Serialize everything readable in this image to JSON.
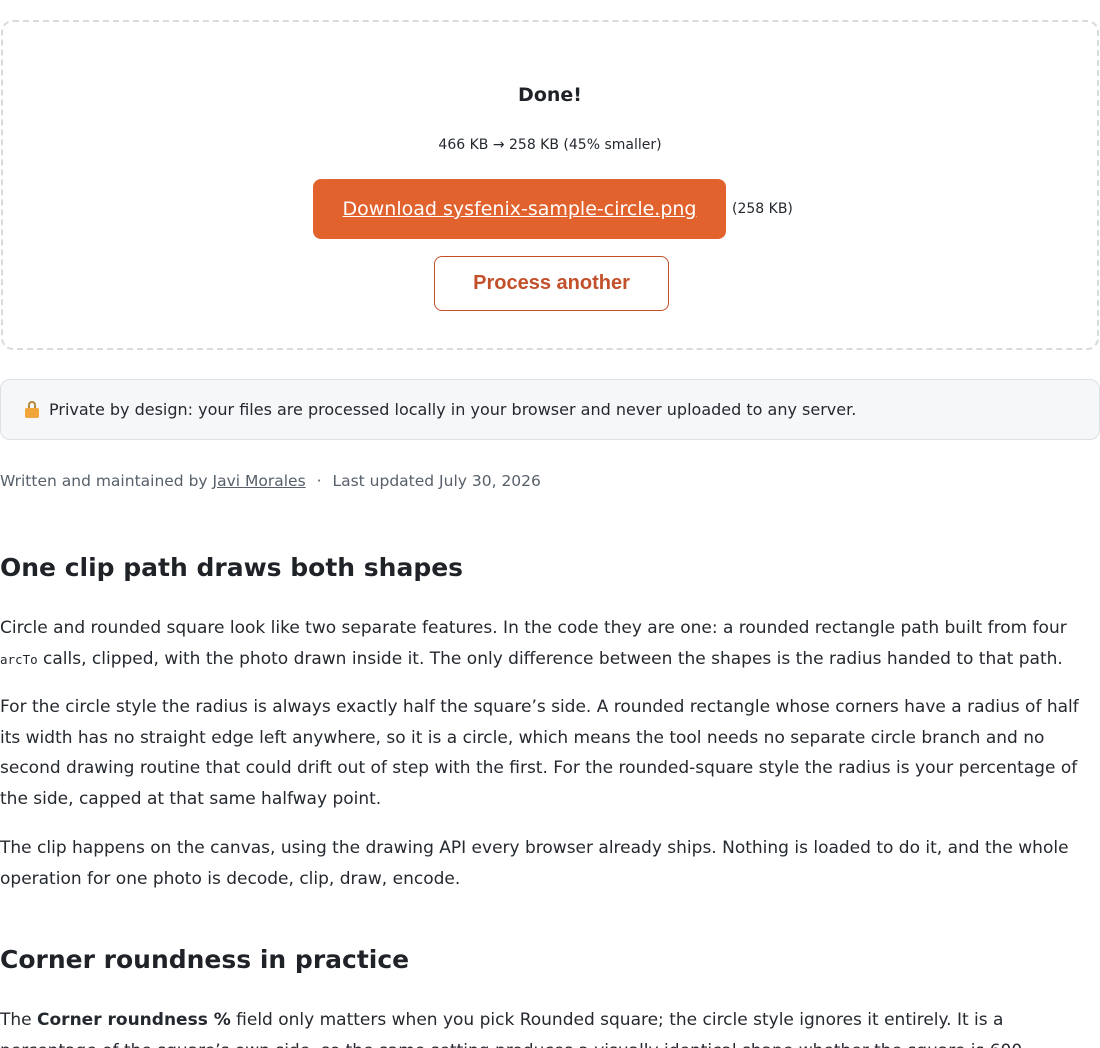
{
  "result": {
    "title": "Done!",
    "size_summary": "466 KB → 258 KB (45% smaller)",
    "download_label": "Download sysfenix-sample-circle.png",
    "download_size": "(258 KB)",
    "process_another_label": "Process another"
  },
  "privacy": {
    "icon": "lock-icon",
    "text": "Private by design: your files are processed locally in your browser and never uploaded to any server."
  },
  "byline": {
    "prefix": "Written and maintained by",
    "author": "Javi Morales",
    "separator": "·",
    "updated": "Last updated July 30, 2026"
  },
  "article": {
    "section1": {
      "heading": "One clip path draws both shapes",
      "p1_before_code": "Circle and rounded square look like two separate features. In the code they are one: a rounded rectangle path built from four",
      "p1_code": "arcTo",
      "p1_after_code": "calls, clipped, with the photo drawn inside it. The only difference between the shapes is the radius handed to that path.",
      "p2": "For the circle style the radius is always exactly half the square’s side. A rounded rectangle whose corners have a radius of half its width has no straight edge left anywhere, so it is a circle, which means the tool needs no separate circle branch and no second drawing routine that could drift out of step with the first. For the rounded-square style the radius is your percentage of the side, capped at that same halfway point.",
      "p3": "The clip happens on the canvas, using the drawing API every browser already ships. Nothing is loaded to do it, and the whole operation for one photo is decode, clip, draw, encode."
    },
    "section2": {
      "heading": "Corner roundness in practice",
      "p1_before_bold": "The",
      "p1_bold": "Corner roundness %",
      "p1_after_bold": "field only matters when you pick Rounded square; the circle style ignores it entirely. It is a percentage of the square’s own side, so the same setting produces a visually identical shape whether the square is 600"
    }
  }
}
